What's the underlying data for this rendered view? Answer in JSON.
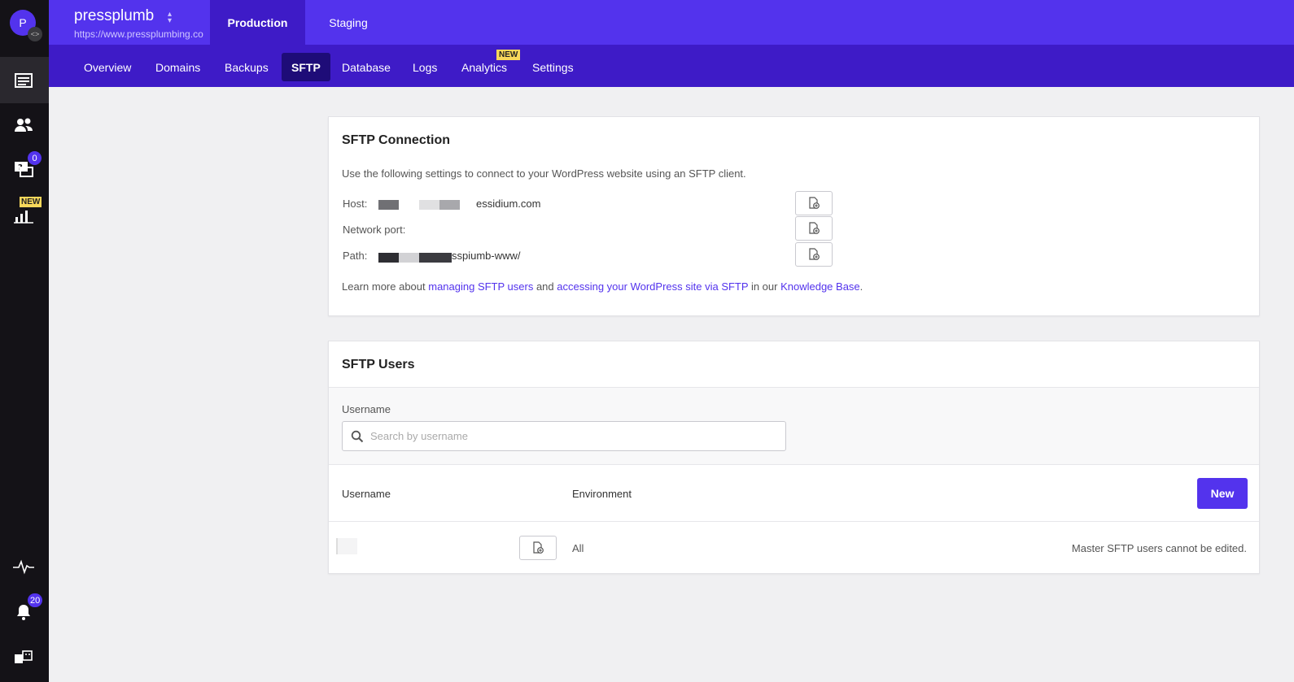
{
  "rail": {
    "avatar_letter": "P",
    "support_badge": "0",
    "analytics_badge": "NEW",
    "notifications_badge": "20"
  },
  "header": {
    "site_name": "pressplumb",
    "site_url": "https://www.pressplumbing.co",
    "env_tabs": [
      "Production",
      "Staging"
    ],
    "active_env": "Production"
  },
  "subnav": {
    "items": [
      "Overview",
      "Domains",
      "Backups",
      "SFTP",
      "Database",
      "Logs",
      "Analytics",
      "Settings"
    ],
    "active": "SFTP",
    "new_badge": "NEW"
  },
  "connection": {
    "title": "SFTP Connection",
    "description": "Use the following settings to connect to your WordPress website using an SFTP client.",
    "host_label": "Host:",
    "host_value_suffix": "essidium.com",
    "port_label": "Network port:",
    "path_label": "Path:",
    "path_value_suffix": "sspiumb-www/",
    "learn_prefix": "Learn more about ",
    "link_managing": "managing SFTP users",
    "and_text": " and ",
    "link_accessing": "accessing your WordPress site via SFTP",
    "in_our": " in our ",
    "link_kb": "Knowledge Base",
    "period": "."
  },
  "users": {
    "title": "SFTP Users",
    "filter_label": "Username",
    "search_placeholder": "Search by username",
    "col_username": "Username",
    "col_environment": "Environment",
    "new_button": "New",
    "rows": [
      {
        "environment": "All",
        "note": "Master SFTP users cannot be edited."
      }
    ]
  },
  "colors": {
    "brand": "#5333ed",
    "brand_dark": "#3e1bc7",
    "rail": "#141217"
  }
}
